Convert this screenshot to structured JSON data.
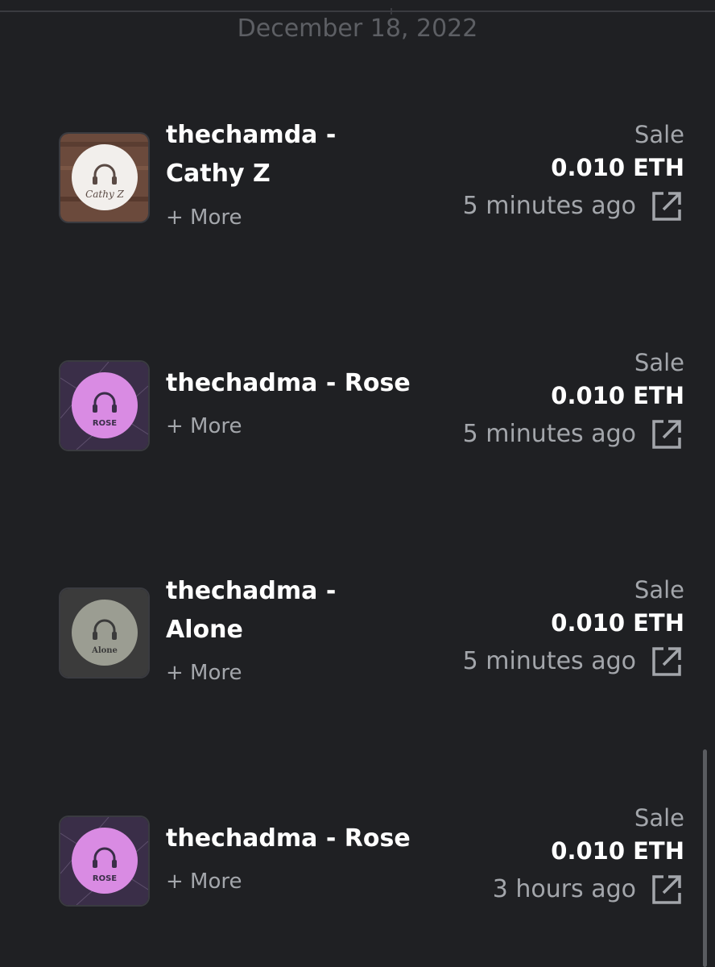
{
  "date_header": "December 18, 2022",
  "colors": {
    "background": "#1f2023",
    "muted_text": "#a3a6ab",
    "primary_text": "#ffffff"
  },
  "activities": [
    {
      "title_line1": "thechamda -",
      "title_line2": "Cathy Z",
      "more": "+ More",
      "event": "Sale",
      "price": "0.010 ETH",
      "time": "5 minutes ago",
      "cover_label": "Cathy Z",
      "icon": "external-link-icon"
    },
    {
      "title_line1": "thechadma - Rose",
      "more": "+ More",
      "event": "Sale",
      "price": "0.010 ETH",
      "time": "5 minutes ago",
      "cover_label": "ROSE",
      "icon": "external-link-icon"
    },
    {
      "title_line1": "thechadma -",
      "title_line2": "Alone",
      "more": "+ More",
      "event": "Sale",
      "price": "0.010 ETH",
      "time": "5 minutes ago",
      "cover_label": "Alone",
      "icon": "external-link-icon"
    },
    {
      "title_line1": "thechadma - Rose",
      "more": "+ More",
      "event": "Sale",
      "price": "0.010 ETH",
      "time": "3 hours ago",
      "cover_label": "ROSE",
      "icon": "external-link-icon"
    }
  ]
}
